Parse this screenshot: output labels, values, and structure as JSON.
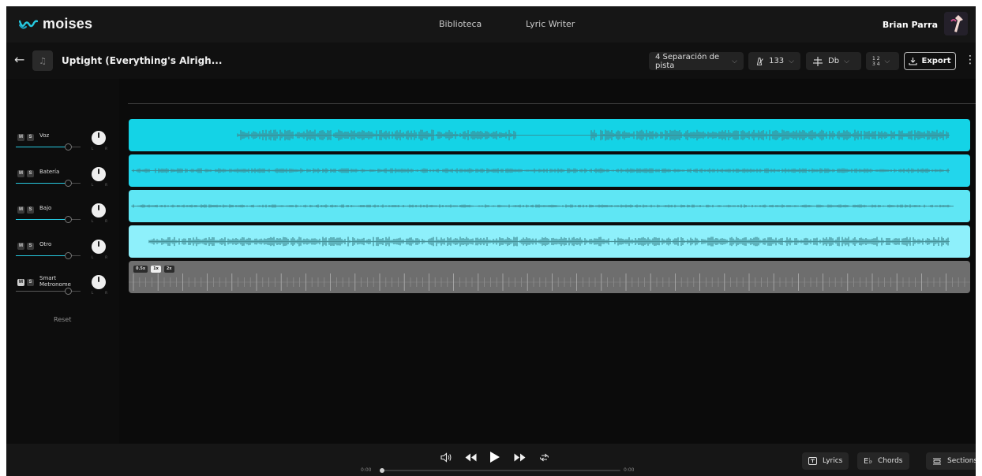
{
  "brand": {
    "name": "moises",
    "accent": "#27c9e0"
  },
  "topnav": {
    "links": [
      "Biblioteca",
      "Lyric Writer"
    ],
    "user_name": "Brian Parra"
  },
  "song": {
    "title": "Uptight (Everything's Alrigh...",
    "separation": "4 Separación de pista",
    "bpm": "133",
    "key": "Db",
    "time_signature_top": "1 2",
    "time_signature_bottom": "3 4",
    "export_label": "Export"
  },
  "tracks": [
    {
      "name": "Voz",
      "color": "#14d3e6",
      "volume": 0.8,
      "pan": 0
    },
    {
      "name": "Batería",
      "color": "#22d6ec",
      "volume": 0.8,
      "pan": 0
    },
    {
      "name": "Bajo",
      "color": "#5fe6f4",
      "volume": 0.8,
      "pan": 0
    },
    {
      "name": "Otro",
      "color": "#8ef0fb",
      "volume": 0.8,
      "pan": 0
    },
    {
      "name": "Smart Metronome",
      "name_line1": "Smart",
      "name_line2": "Metronome",
      "color": "#6e6e6e",
      "volume": 0.8,
      "pan": 0
    }
  ],
  "mute_label": "M",
  "solo_label": "S",
  "pan_left": "L",
  "pan_right": "R",
  "reset_label": "Reset",
  "metronome_speeds": [
    "0.5x",
    "1x",
    "2x"
  ],
  "metronome_active_speed": "1x",
  "transport": {
    "time_current": "0:00",
    "time_total": "0:00",
    "progress": 0
  },
  "bottom_buttons": {
    "lyrics": "Lyrics",
    "chords": "Chords",
    "sections": "Sections"
  },
  "icons": [
    "moises-logo-icon",
    "back-arrow-icon",
    "music-note-icon",
    "metronome-icon",
    "tuning-fork-icon",
    "download-icon",
    "kebab-menu-icon",
    "volume-icon",
    "rewind-icon",
    "play-icon",
    "fast-forward-icon",
    "loop-icon"
  ]
}
